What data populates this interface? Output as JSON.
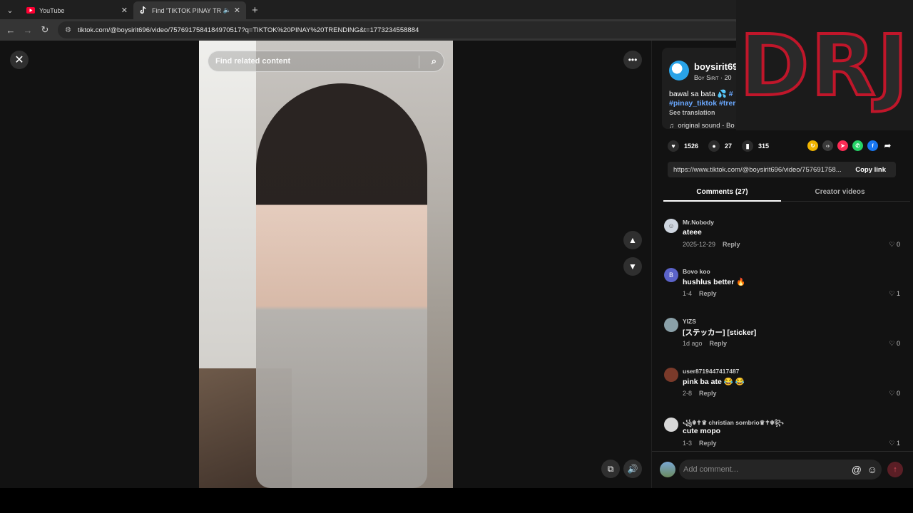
{
  "browser": {
    "tabs": [
      {
        "title": "YouTube",
        "active": false
      },
      {
        "title": "Find 'TIKTOK PINAY TREND",
        "active": true
      }
    ],
    "url": "tiktok.com/@boysirit696/video/7576917584184970517?q=TIKTOK%20PINAY%20TRENDING&t=1773234558884"
  },
  "video": {
    "search_placeholder": "Find related content"
  },
  "post": {
    "username": "boysirit69",
    "subline": "Boy Sirit · 20",
    "caption_line1_text": "bawal sa bata 💦 ",
    "caption_line1_tag": "#",
    "caption_line2": "#pinay_tiktok #trer",
    "see_translation": "See translation",
    "sound": "original sound - Bo",
    "likes": "1526",
    "comments": "27",
    "saves": "315",
    "link": "https://www.tiktok.com/@boysirit696/video/757691758...",
    "copy_link": "Copy link"
  },
  "panel_tabs": {
    "comments": "Comments (27)",
    "creator_videos": "Creator videos"
  },
  "comments": [
    {
      "user": "Mr.Nobody",
      "text": "ateee",
      "date": "2025-12-29",
      "reply": "Reply",
      "likes": "0",
      "avatar_color": "#cfd6e0",
      "avatar_letter": ""
    },
    {
      "user": "Bovo koo",
      "text": "hushlus better 🔥",
      "date": "1-4",
      "reply": "Reply",
      "likes": "1",
      "avatar_color": "#5b63c9",
      "avatar_letter": "B"
    },
    {
      "user": "YIZS",
      "text": "[ステッカー] [sticker]",
      "date": "1d ago",
      "reply": "Reply",
      "likes": "0",
      "avatar_color": "#8aa0a8",
      "avatar_letter": ""
    },
    {
      "user": "user8719447417487",
      "text": "pink ba ate 😂 😂",
      "date": "2-8",
      "reply": "Reply",
      "likes": "0",
      "avatar_color": "#7a3a2a",
      "avatar_letter": ""
    },
    {
      "user": "꧁☬✝♛ christian sombrio♛✝☬꧂",
      "text": "cute mopo",
      "date": "1-3",
      "reply": "Reply",
      "likes": "1",
      "avatar_color": "#d8d8d8",
      "avatar_letter": ""
    }
  ],
  "comment_input": {
    "placeholder": "Add comment..."
  },
  "overlay_logo": "DRJ",
  "colors": {
    "link_blue": "#6aa8ff",
    "logo_red": "#c0162a",
    "background": "#121212"
  }
}
